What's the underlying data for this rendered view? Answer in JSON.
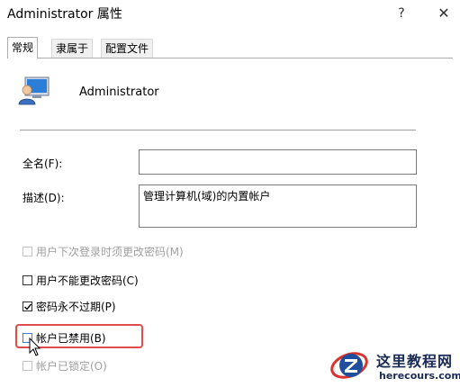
{
  "window": {
    "title": "Administrator 属性",
    "help_label": "?",
    "close_label": "✕"
  },
  "tabs": [
    {
      "label": "常规",
      "active": true
    },
    {
      "label": "隶属于",
      "active": false
    },
    {
      "label": "配置文件",
      "active": false
    }
  ],
  "user": {
    "name": "Administrator",
    "icon": "user-account-icon"
  },
  "fields": {
    "fullname": {
      "label": "全名(F):",
      "value": ""
    },
    "description": {
      "label": "描述(D):",
      "value": "管理计算机(域)的内置帐户"
    }
  },
  "checkboxes": [
    {
      "label": "用户下次登录时须更改密码(M)",
      "checked": false,
      "disabled": true
    },
    {
      "label": "用户不能更改密码(C)",
      "checked": false,
      "disabled": false
    },
    {
      "label": "密码永不过期(P)",
      "checked": true,
      "disabled": false
    },
    {
      "label": "帐户已禁用(B)",
      "checked": false,
      "disabled": false
    },
    {
      "label": "帐户已锁定(O)",
      "checked": false,
      "disabled": true
    }
  ],
  "watermark": {
    "name": "这里教程网",
    "url": "herecours.com"
  },
  "colors": {
    "highlight": "#e24b4b",
    "disabled_text": "#a0a0a0"
  }
}
